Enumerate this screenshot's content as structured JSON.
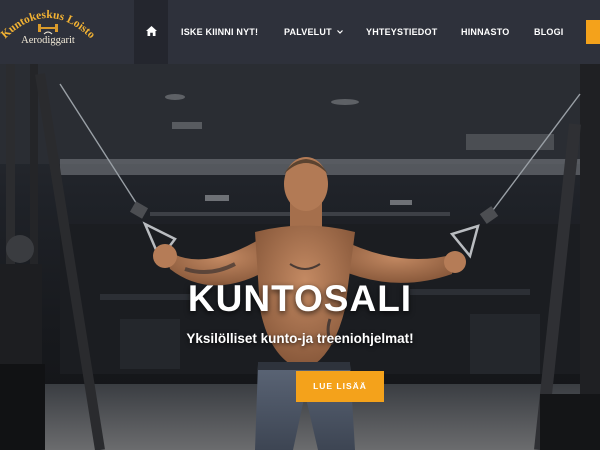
{
  "brand": {
    "name": "Kuntokeskus Loisto",
    "sub": "Aerodiggarit"
  },
  "nav": {
    "home_icon": "home-icon",
    "items": [
      {
        "label": "ISKE KIINNI NYT!"
      },
      {
        "label": "PALVELUT",
        "dropdown": true
      },
      {
        "label": "YHTEYSTIEDOT"
      },
      {
        "label": "HINNASTO"
      },
      {
        "label": "BLOGI"
      }
    ],
    "cta_color": "#f4a21b"
  },
  "hero": {
    "title": "KUNTOSALI",
    "subtitle": "Yksilölliset kunto-ja treeniohjelmat!",
    "button_label": "LUE LISÄÄ"
  },
  "colors": {
    "nav_bg": "#2e313b",
    "accent": "#f4a21b"
  }
}
